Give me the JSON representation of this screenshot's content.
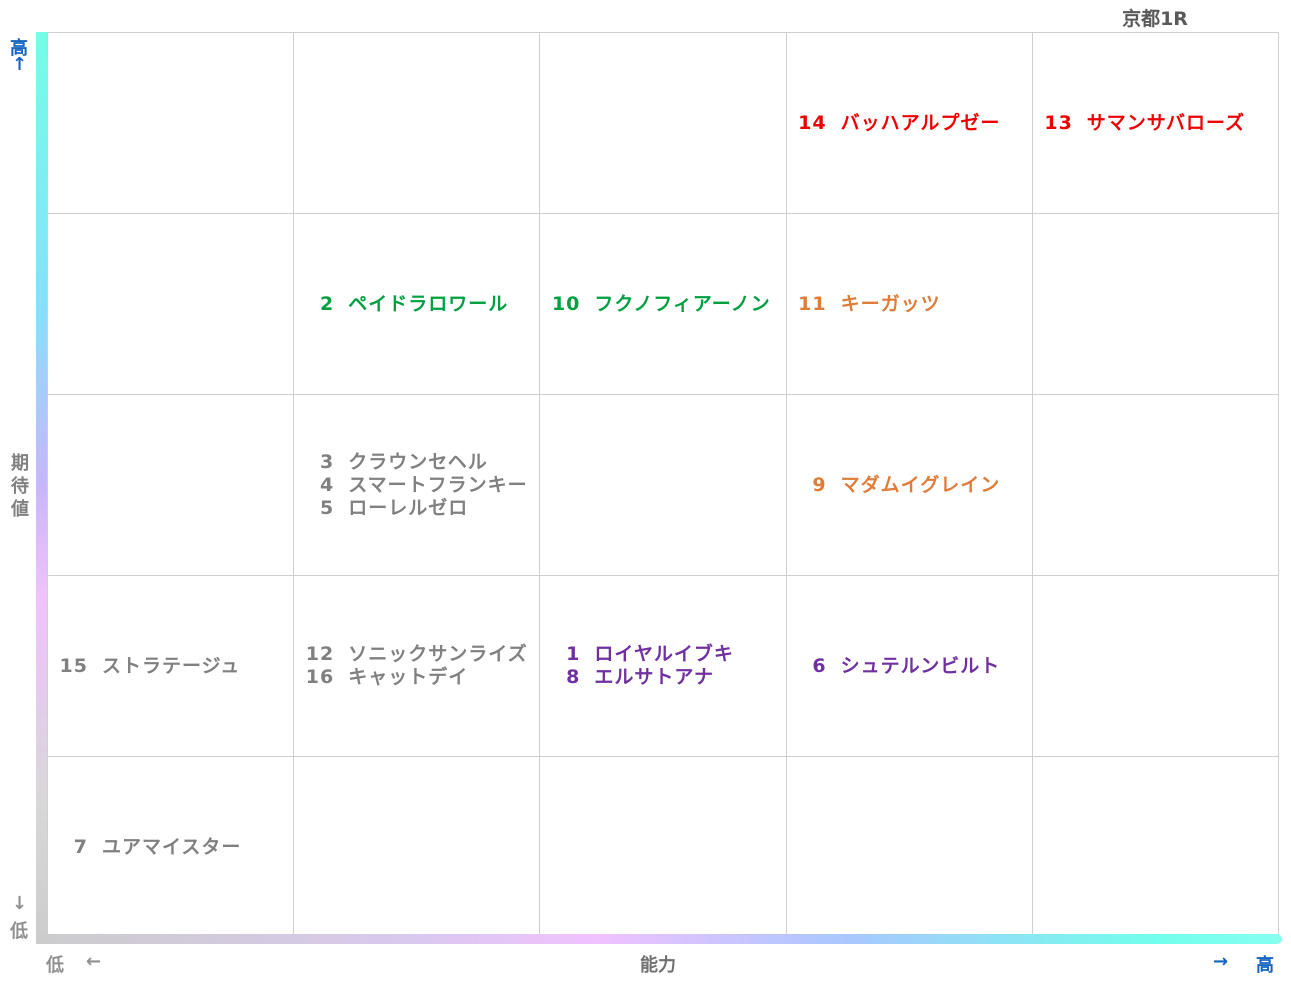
{
  "title": "京都1R",
  "y_axis": {
    "label": "期待値",
    "high": "高",
    "high_arrow": "↑",
    "low_arrow": "↓",
    "low": "低"
  },
  "x_axis": {
    "label": "能力",
    "low": "低",
    "low_arrow": "←",
    "high_arrow": "→",
    "high": "高"
  },
  "colors": {
    "red": "#ee0000",
    "green": "#00a040",
    "orange": "#e07b39",
    "gray": "#808080",
    "purple": "#7030a0"
  },
  "chart_data": {
    "type": "table",
    "title": "京都1R",
    "xlabel": "能力",
    "ylabel": "期待値",
    "columns": 5,
    "rows": 5,
    "cells": [
      {
        "row": 1,
        "col": 4,
        "color": "red",
        "horses": [
          {
            "num": "14",
            "name": "バッハアルプゼー"
          }
        ]
      },
      {
        "row": 1,
        "col": 5,
        "color": "red",
        "horses": [
          {
            "num": "13",
            "name": "サマンサバローズ"
          }
        ]
      },
      {
        "row": 2,
        "col": 2,
        "color": "green",
        "horses": [
          {
            "num": "2",
            "name": "ペイドラロワール"
          }
        ]
      },
      {
        "row": 2,
        "col": 3,
        "color": "green",
        "horses": [
          {
            "num": "10",
            "name": "フクノフィアーノン"
          }
        ]
      },
      {
        "row": 2,
        "col": 4,
        "color": "orange",
        "horses": [
          {
            "num": "11",
            "name": "キーガッツ"
          }
        ]
      },
      {
        "row": 3,
        "col": 2,
        "color": "gray",
        "horses": [
          {
            "num": "3",
            "name": "クラウンセヘル"
          },
          {
            "num": "4",
            "name": "スマートフランキー"
          },
          {
            "num": "5",
            "name": "ローレルゼロ"
          }
        ]
      },
      {
        "row": 3,
        "col": 4,
        "color": "orange",
        "horses": [
          {
            "num": "9",
            "name": "マダムイグレイン"
          }
        ]
      },
      {
        "row": 4,
        "col": 1,
        "color": "gray",
        "horses": [
          {
            "num": "15",
            "name": "ストラテージュ"
          }
        ]
      },
      {
        "row": 4,
        "col": 2,
        "color": "gray",
        "horses": [
          {
            "num": "12",
            "name": "ソニックサンライズ"
          },
          {
            "num": "16",
            "name": "キャットデイ"
          }
        ]
      },
      {
        "row": 4,
        "col": 3,
        "color": "purple",
        "horses": [
          {
            "num": "1",
            "name": "ロイヤルイブキ"
          },
          {
            "num": "8",
            "name": "エルサトアナ"
          }
        ]
      },
      {
        "row": 4,
        "col": 4,
        "color": "purple",
        "horses": [
          {
            "num": "6",
            "name": "シュテルンビルト"
          }
        ]
      },
      {
        "row": 5,
        "col": 1,
        "color": "gray",
        "horses": [
          {
            "num": "7",
            "name": "ユアマイスター"
          }
        ]
      }
    ]
  }
}
